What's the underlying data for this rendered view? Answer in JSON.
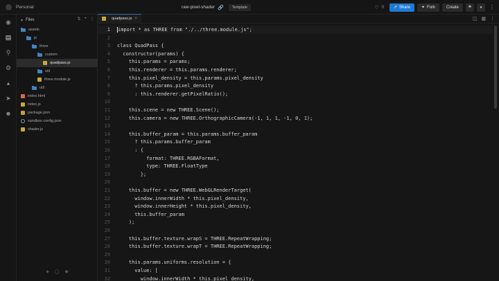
{
  "topbar": {
    "workspace": "Personal",
    "project": "raw-pixel-shader",
    "template_badge": "Template",
    "likes": "0",
    "share": "Share",
    "fork": "Fork",
    "create": "Create"
  },
  "explorer": {
    "title": "Files",
    "items": [
      {
        "label": "assets",
        "type": "folder",
        "depth": 0
      },
      {
        "label": "js",
        "type": "folder",
        "depth": 1
      },
      {
        "label": "three",
        "type": "folder",
        "depth": 2
      },
      {
        "label": "custom",
        "type": "folder",
        "depth": 3
      },
      {
        "label": "quadpass.js",
        "type": "js",
        "depth": 4,
        "selected": true
      },
      {
        "label": "util",
        "type": "folder",
        "depth": 3
      },
      {
        "label": "three.module.js",
        "type": "js",
        "depth": 3
      },
      {
        "label": "util",
        "type": "folder",
        "depth": 2
      },
      {
        "label": "index.html",
        "type": "html",
        "depth": 0
      },
      {
        "label": "index.js",
        "type": "js",
        "depth": 0
      },
      {
        "label": "package.json",
        "type": "json",
        "depth": 0
      },
      {
        "label": "sandbox.config.json",
        "type": "gear",
        "depth": 0
      },
      {
        "label": "shader.js",
        "type": "js",
        "depth": 0
      }
    ]
  },
  "editor": {
    "tab_label": "quadpass.js",
    "lines": [
      {
        "n": "1",
        "code": "import * as THREE from \"./../three.module.js\";"
      },
      {
        "n": "2",
        "code": ""
      },
      {
        "n": "3",
        "code": "class QuadPass {"
      },
      {
        "n": "4",
        "code": "  constructor(params) {"
      },
      {
        "n": "5",
        "code": "    this.params = params;"
      },
      {
        "n": "6",
        "code": "    this.renderer = this.params.renderer;"
      },
      {
        "n": "7",
        "code": "    this.pixel_density = this.params.pixel_density"
      },
      {
        "n": "8",
        "code": "      ? this.params.pixel_density"
      },
      {
        "n": "9",
        "code": "      : this.renderer.getPixelRatio();"
      },
      {
        "n": "10",
        "code": ""
      },
      {
        "n": "11",
        "code": "    this.scene = new THREE.Scene();"
      },
      {
        "n": "12",
        "code": "    this.camera = new THREE.OrthographicCamera(-1, 1, 1, -1, 0, 1);"
      },
      {
        "n": "13",
        "code": ""
      },
      {
        "n": "14",
        "code": "    this.buffer_param = this.params.buffer_param"
      },
      {
        "n": "15",
        "code": "      ? this.params.buffer_param"
      },
      {
        "n": "16",
        "code": "      : {"
      },
      {
        "n": "17",
        "code": "          format: THREE.RGBAFormat,"
      },
      {
        "n": "18",
        "code": "          type: THREE.FloatType"
      },
      {
        "n": "19",
        "code": "        };"
      },
      {
        "n": "20",
        "code": ""
      },
      {
        "n": "21",
        "code": "    this.buffer = new THREE.WebGLRenderTarget("
      },
      {
        "n": "22",
        "code": "      window.innerWidth * this.pixel_density,"
      },
      {
        "n": "23",
        "code": "      window.innerHeight * this.pixel_density,"
      },
      {
        "n": "24",
        "code": "      this.buffer_param"
      },
      {
        "n": "25",
        "code": "    );"
      },
      {
        "n": "26",
        "code": ""
      },
      {
        "n": "27",
        "code": "    this.buffer.texture.wrapS = THREE.RepeatWrapping;"
      },
      {
        "n": "28",
        "code": "    this.buffer.texture.wrapT = THREE.RepeatWrapping;"
      },
      {
        "n": "29",
        "code": ""
      },
      {
        "n": "30",
        "code": "    this.params.uniforms.resolution = {"
      },
      {
        "n": "31",
        "code": "      value: ["
      },
      {
        "n": "32",
        "code": "        window.innerWidth * this.pixel_density,"
      }
    ]
  },
  "colors": {
    "accent": "#1f7ad6",
    "folder": "#3d86c6",
    "keyword": "#e0c24f"
  }
}
